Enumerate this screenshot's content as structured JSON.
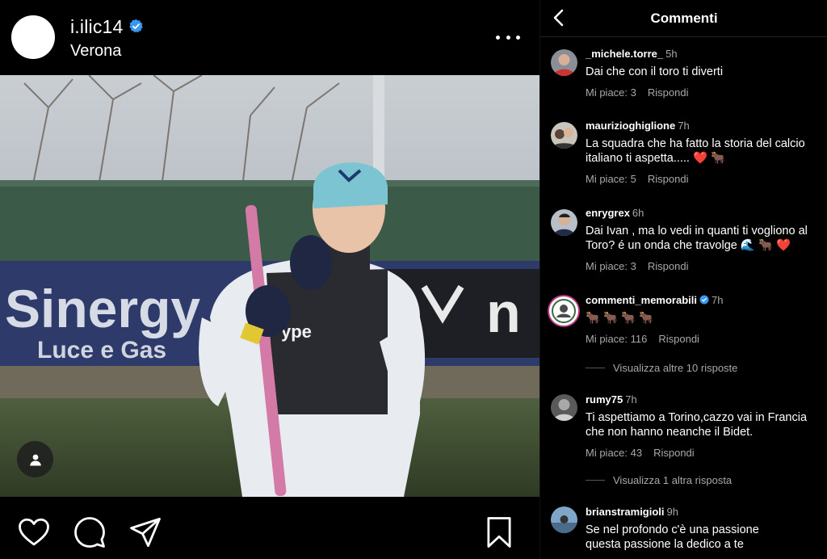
{
  "post": {
    "username": "i.ilic14",
    "location": "Verona"
  },
  "photo": {
    "banner_text": "Sinergy",
    "banner_subtext": "Luce e Gas",
    "shirt_text": "ype"
  },
  "comments_panel": {
    "title": "Commenti",
    "comments": [
      {
        "user": "_michele.torre_",
        "time": "5h",
        "text": "Dai che con il toro ti diverti",
        "likes": "Mi piace: 3",
        "reply": "Rispondi"
      },
      {
        "user": "maurizioghiglione",
        "time": "7h",
        "text": "La squadra che ha fatto la storia del calcio italiano ti aspetta..... ❤️ 🐂",
        "likes": "Mi piace: 5",
        "reply": "Rispondi"
      },
      {
        "user": "enrygrex",
        "time": "6h",
        "text": "Dai Ivan , ma lo vedi in quanti ti vogliono al Toro? é un onda che travolge 🌊 🐂 ❤️",
        "likes": "Mi piace: 3",
        "reply": "Rispondi"
      },
      {
        "user": "commenti_memorabili",
        "time": "7h",
        "text": "🐂 🐂 🐂 🐂",
        "likes": "Mi piace: 116",
        "reply": "Rispondi"
      },
      {
        "user": "rumy75",
        "time": "7h",
        "text": "Ti aspettiamo a Torino,cazzo vai in Francia che non hanno neanche il Bidet.",
        "likes": "Mi piace: 43",
        "reply": "Rispondi"
      },
      {
        "user": "brianstramigioli",
        "time": "9h",
        "text": "Se nel profondo c'è una passione questa passione la dedico a te",
        "likes": "",
        "reply": ""
      }
    ],
    "view_more_1": "Visualizza altre 10 risposte",
    "view_more_2": "Visualizza 1 altra risposta"
  },
  "icons": [
    "verified-badge-icon",
    "more-options-icon",
    "user-tag-icon",
    "heart-icon",
    "comment-icon",
    "share-icon",
    "bookmark-icon",
    "back-arrow-icon"
  ],
  "colors": {
    "background": "#000000",
    "verified_blue": "#3897f0",
    "secondary_text": "#a8a8a8",
    "heart_red": "#ed2b3a"
  }
}
